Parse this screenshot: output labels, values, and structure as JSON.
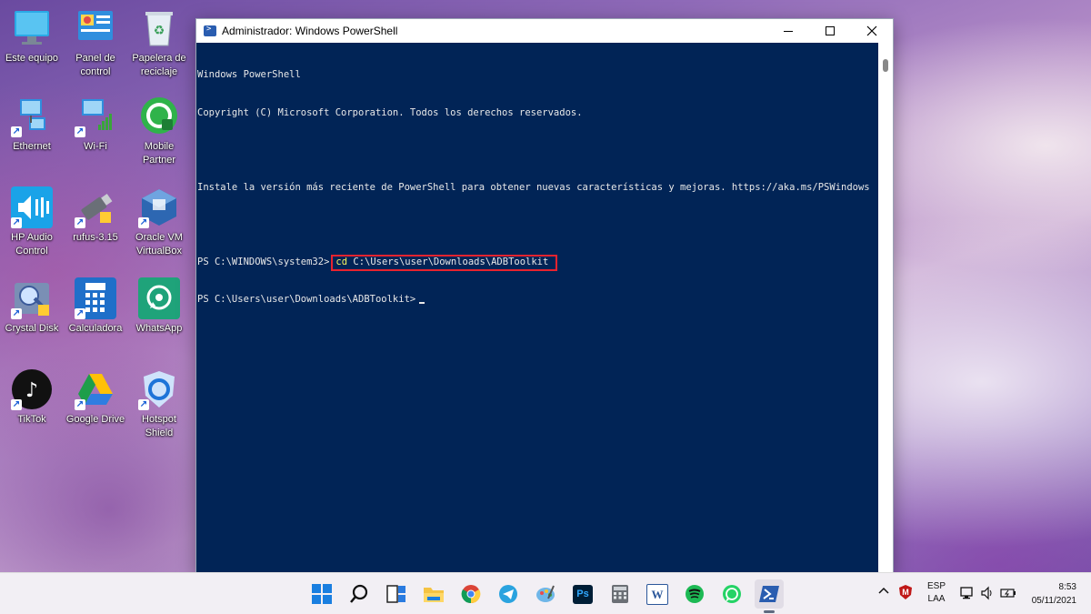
{
  "desktop": {
    "icons": [
      {
        "label": "Este equipo",
        "icon": "monitor-icon"
      },
      {
        "label": "Panel de control",
        "icon": "control-panel-icon"
      },
      {
        "label": "Papelera de reciclaje",
        "icon": "recycle-bin-icon"
      },
      {
        "label": "Ethernet",
        "icon": "network-icon"
      },
      {
        "label": "Wi-Fi",
        "icon": "wifi-icon"
      },
      {
        "label": "Mobile Partner",
        "icon": "mobile-partner-icon"
      },
      {
        "label": "HP Audio Control",
        "icon": "audio-control-icon"
      },
      {
        "label": "rufus-3.15",
        "icon": "usb-drive-icon"
      },
      {
        "label": "Oracle VM VirtualBox",
        "icon": "virtualbox-icon"
      },
      {
        "label": "Crystal Disk",
        "icon": "crystal-disk-icon"
      },
      {
        "label": "Calculadora",
        "icon": "calculator-icon"
      },
      {
        "label": "WhatsApp",
        "icon": "whatsapp-icon"
      },
      {
        "label": "TikTok",
        "icon": "tiktok-icon"
      },
      {
        "label": "Google Drive",
        "icon": "google-drive-icon"
      },
      {
        "label": "Hotspot Shield",
        "icon": "hotspot-shield-icon"
      }
    ]
  },
  "window": {
    "title": "Administrador: Windows PowerShell",
    "console": {
      "line1": "Windows PowerShell",
      "line2": "Copyright (C) Microsoft Corporation. Todos los derechos reservados.",
      "line3": "Instale la versión más reciente de PowerShell para obtener nuevas características y mejoras. https://aka.ms/PSWindows",
      "prompt1": "PS C:\\WINDOWS\\system32>",
      "cmd_keyword": "cd",
      "cmd_arg": " C:\\Users\\user\\Downloads\\ADBToolkit",
      "prompt2": "PS C:\\Users\\user\\Downloads\\ADBToolkit>"
    }
  },
  "taskbar": {
    "icons": [
      "windows-start-icon",
      "search-icon",
      "task-view-icon",
      "file-explorer-icon",
      "chrome-icon",
      "telegram-icon",
      "paint-icon",
      "photoshop-icon",
      "calculator-icon",
      "word-icon",
      "spotify-icon",
      "whatsapp-icon",
      "powershell-icon"
    ],
    "ps_label": "Ps",
    "word_label": "W",
    "lang_top": "ESP",
    "lang_bottom": "LAA",
    "time": "8:53",
    "date": "05/11/2021"
  },
  "colors": {
    "console_bg": "#012456",
    "console_text": "#e8e8e8",
    "keyword": "#f8f45e",
    "highlight_box": "#e8232f"
  }
}
